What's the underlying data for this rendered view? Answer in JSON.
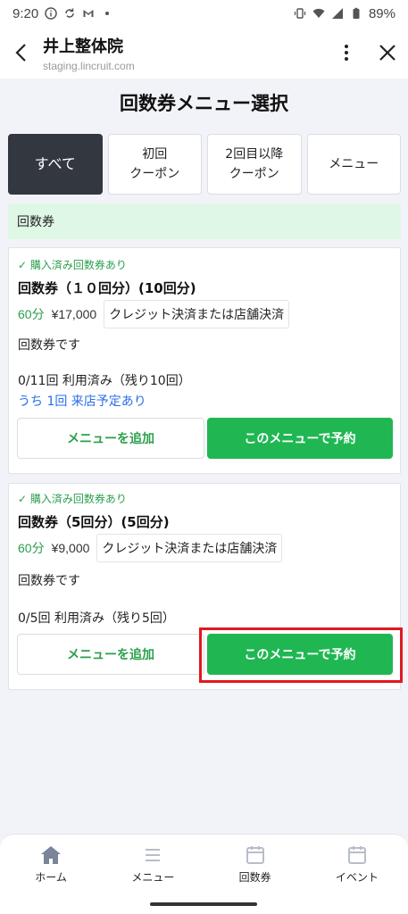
{
  "status_bar": {
    "time": "9:20",
    "battery": "89%"
  },
  "header": {
    "title": "井上整体院",
    "url": "staging.lincruit.com"
  },
  "page_title": "回数券メニュー選択",
  "tabs": [
    {
      "label": "すべて",
      "active": true
    },
    {
      "label": "初回\nクーポン",
      "active": false
    },
    {
      "label": "2回目以降\nクーポン",
      "active": false
    },
    {
      "label": "メニュー",
      "active": false
    }
  ],
  "section": {
    "title": "回数券"
  },
  "cards": [
    {
      "purchased": "✓ 購入済み回数券あり",
      "name": "回数券（１０回分）(10回分)",
      "duration": "60分",
      "price": "¥17,000",
      "payment": "クレジット決済または店舗決済",
      "description": "回数券です",
      "usage": "0/11回 利用済み（残り10回）",
      "reserved": "うち 1回 来店予定あり",
      "add_label": "メニューを追加",
      "book_label": "このメニューで予約"
    },
    {
      "purchased": "✓ 購入済み回数券あり",
      "name": "回数券（5回分）(5回分)",
      "duration": "60分",
      "price": "¥9,000",
      "payment": "クレジット決済または店舗決済",
      "description": "回数券です",
      "usage": "0/5回 利用済み（残り5回）",
      "add_label": "メニューを追加",
      "book_label": "このメニューで予約"
    }
  ],
  "bottom_nav": [
    {
      "label": "ホーム",
      "icon": "home-icon"
    },
    {
      "label": "メニュー",
      "icon": "menu-list-icon"
    },
    {
      "label": "回数券",
      "icon": "calendar-icon"
    },
    {
      "label": "イベント",
      "icon": "calendar-icon"
    }
  ],
  "colors": {
    "accent_green": "#20b753",
    "tab_active": "#33373f",
    "highlight_red": "#e0191f",
    "link_blue": "#2a6ee8"
  }
}
